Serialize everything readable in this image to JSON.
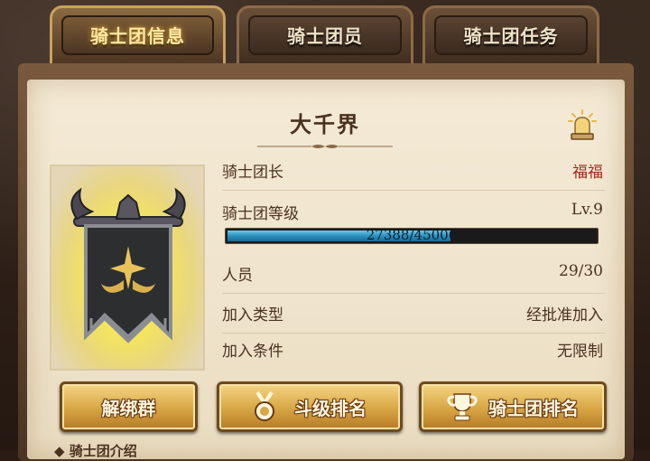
{
  "tabs": [
    {
      "label": "骑士团信息",
      "active": true
    },
    {
      "label": "骑士团员",
      "active": false
    },
    {
      "label": "骑士团任务",
      "active": false
    }
  ],
  "guild": {
    "name": "大千界",
    "rows": {
      "leader_label": "骑士团长",
      "leader_value": "福福",
      "level_label": "骑士团等级",
      "level_value": "Lv.9",
      "exp_text": "27388/45000",
      "exp_fraction": 0.6086,
      "members_label": "人员",
      "members_value": "29/30",
      "join_type_label": "加入类型",
      "join_type_value": "经批准加入",
      "join_cond_label": "加入条件",
      "join_cond_value": "无限制"
    }
  },
  "buttons": {
    "unbind": "解绑群",
    "rank_battle": "斗级排名",
    "rank_guild": "骑士团排名"
  },
  "intro_label": "◆ 骑士团介绍",
  "icons": {
    "notify": "bell-alert-icon",
    "medal": "medal-icon",
    "trophy": "trophy-icon",
    "emblem": "guild-banner-emblem"
  },
  "colors": {
    "leader_name": "#9a2a1e",
    "exp_bar": "#2b8fbf",
    "button_gold": "#d8a544"
  }
}
